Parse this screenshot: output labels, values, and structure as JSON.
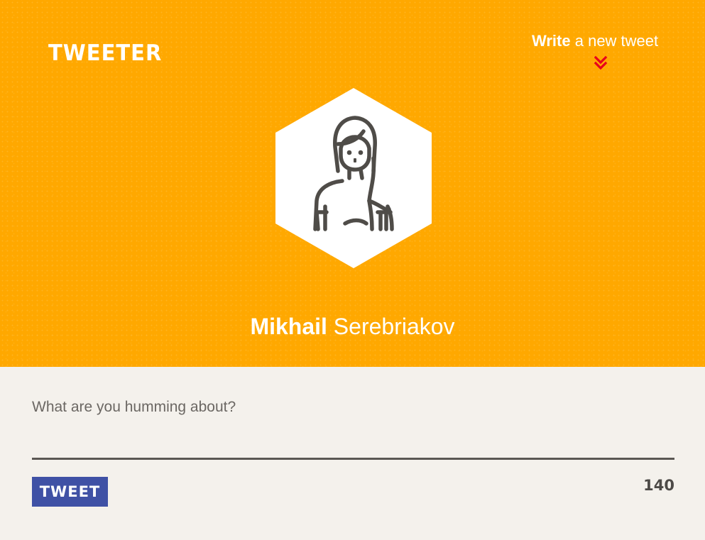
{
  "colors": {
    "hero_background": "#ffa800",
    "compose_background": "#f4f1ec",
    "accent_chevron": "#e8001c",
    "button_background": "#3f51a5",
    "text_dark": "#4d4a47"
  },
  "header": {
    "logo_text": "TWEETER",
    "write_link": {
      "strong": "Write",
      "rest": "a new tweet",
      "icon": "chevron-double-down-icon"
    }
  },
  "profile": {
    "avatar_icon": "woman-avatar-icon",
    "first_name": "Mikhail",
    "last_name": "Serebriakov"
  },
  "compose": {
    "placeholder": "What are you humming about?",
    "value": "",
    "button_label": "TWEET",
    "char_count": "140"
  }
}
